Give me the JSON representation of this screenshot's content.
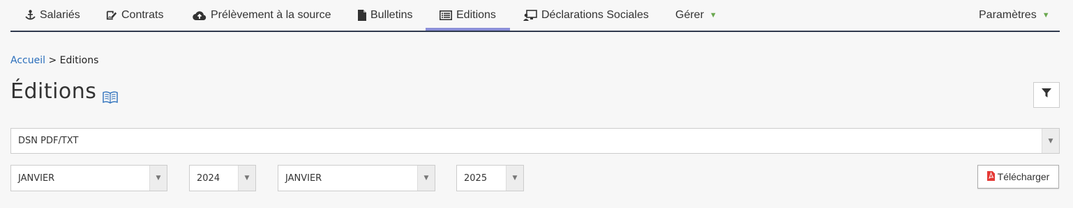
{
  "nav": {
    "items": [
      {
        "label": "Salariés",
        "icon": "person-anchor-icon"
      },
      {
        "label": "Contrats",
        "icon": "signature-icon"
      },
      {
        "label": "Prélèvement à la source",
        "icon": "cloud-upload-icon"
      },
      {
        "label": "Bulletins",
        "icon": "file-icon"
      },
      {
        "label": "Editions",
        "icon": "list-alt-icon"
      },
      {
        "label": "Déclarations Sociales",
        "icon": "monitor-user-icon"
      },
      {
        "label": "Gérer",
        "icon": ""
      },
      {
        "label": "Paramètres",
        "icon": ""
      }
    ],
    "active": "Editions",
    "caret_color": "#6aa84f",
    "active_underline_color": "#8b8fd8"
  },
  "breadcrumb": {
    "home": "Accueil",
    "separator": ">",
    "current": "Editions"
  },
  "page": {
    "title": "Éditions"
  },
  "form": {
    "document_type": "DSN PDF/TXT",
    "from_month": "JANVIER",
    "from_year": "2024",
    "to_month": "JANVIER",
    "to_year": "2025",
    "download_label": "Télécharger"
  },
  "colors": {
    "pdf_icon": "#e53935",
    "link": "#2a6ebb"
  }
}
